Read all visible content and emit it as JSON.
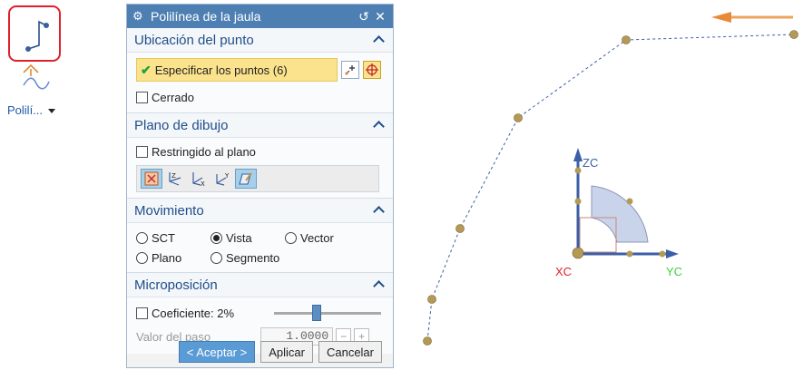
{
  "ribbon": {
    "command_label": "Polilí..."
  },
  "dialog": {
    "title": "Polilínea de la jaula",
    "sections": {
      "point_location": {
        "title": "Ubicación del punto",
        "specify_points": "Especificar los puntos (6)",
        "closed_label": "Cerrado"
      },
      "drawing_plane": {
        "title": "Plano de dibujo",
        "constrained_label": "Restringido al plano"
      },
      "movement": {
        "title": "Movimiento",
        "options": [
          "SCT",
          "Vista",
          "Vector",
          "Plano",
          "Segmento"
        ],
        "selected": "Vista"
      },
      "micro_position": {
        "title": "Microposición",
        "coefficient_label": "Coeficiente: 2%",
        "step_label": "Valor del paso",
        "step_value": "1.0000",
        "step_minus": "−",
        "step_plus": "+"
      }
    },
    "buttons": {
      "ok": "< Aceptar >",
      "apply": "Aplicar",
      "cancel": "Cancelar"
    }
  },
  "viewport": {
    "csys": {
      "z_label": "ZC",
      "x_label": "XC",
      "y_label": "YC"
    }
  },
  "colors": {
    "title_bar": "#4d7fb3",
    "section_title": "#1f4e8a",
    "highlight_field": "#fbe38d",
    "x_axis": "#e0202a",
    "y_axis": "#3fcf3f",
    "point_fill": "#b49a55"
  }
}
